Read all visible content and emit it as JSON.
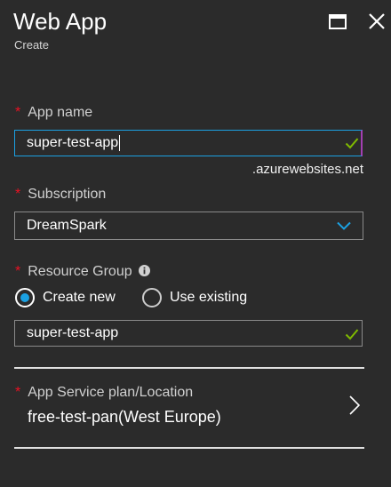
{
  "header": {
    "title": "Web App",
    "subtitle": "Create"
  },
  "form": {
    "app_name": {
      "label": "App name",
      "value": "super-test-app",
      "suffix": ".azurewebsites.net"
    },
    "subscription": {
      "label": "Subscription",
      "value": "DreamSpark"
    },
    "resource_group": {
      "label": "Resource Group",
      "options": [
        "Create new",
        "Use existing"
      ],
      "selected": "Create new",
      "value": "super-test-app"
    },
    "app_service_plan": {
      "label": "App Service plan/Location",
      "value": "free-test-pan(West Europe)"
    },
    "required_marker": "*"
  },
  "colors": {
    "background": "#2b2b2b",
    "accent": "#1ba1e2",
    "required": "#e81123",
    "valid": "#7fba00",
    "focus_edge": "#a33fb2"
  },
  "icons": [
    "maximize-icon",
    "close-icon",
    "checkmark-icon",
    "chevron-down-icon",
    "info-icon",
    "chevron-right-icon"
  ]
}
